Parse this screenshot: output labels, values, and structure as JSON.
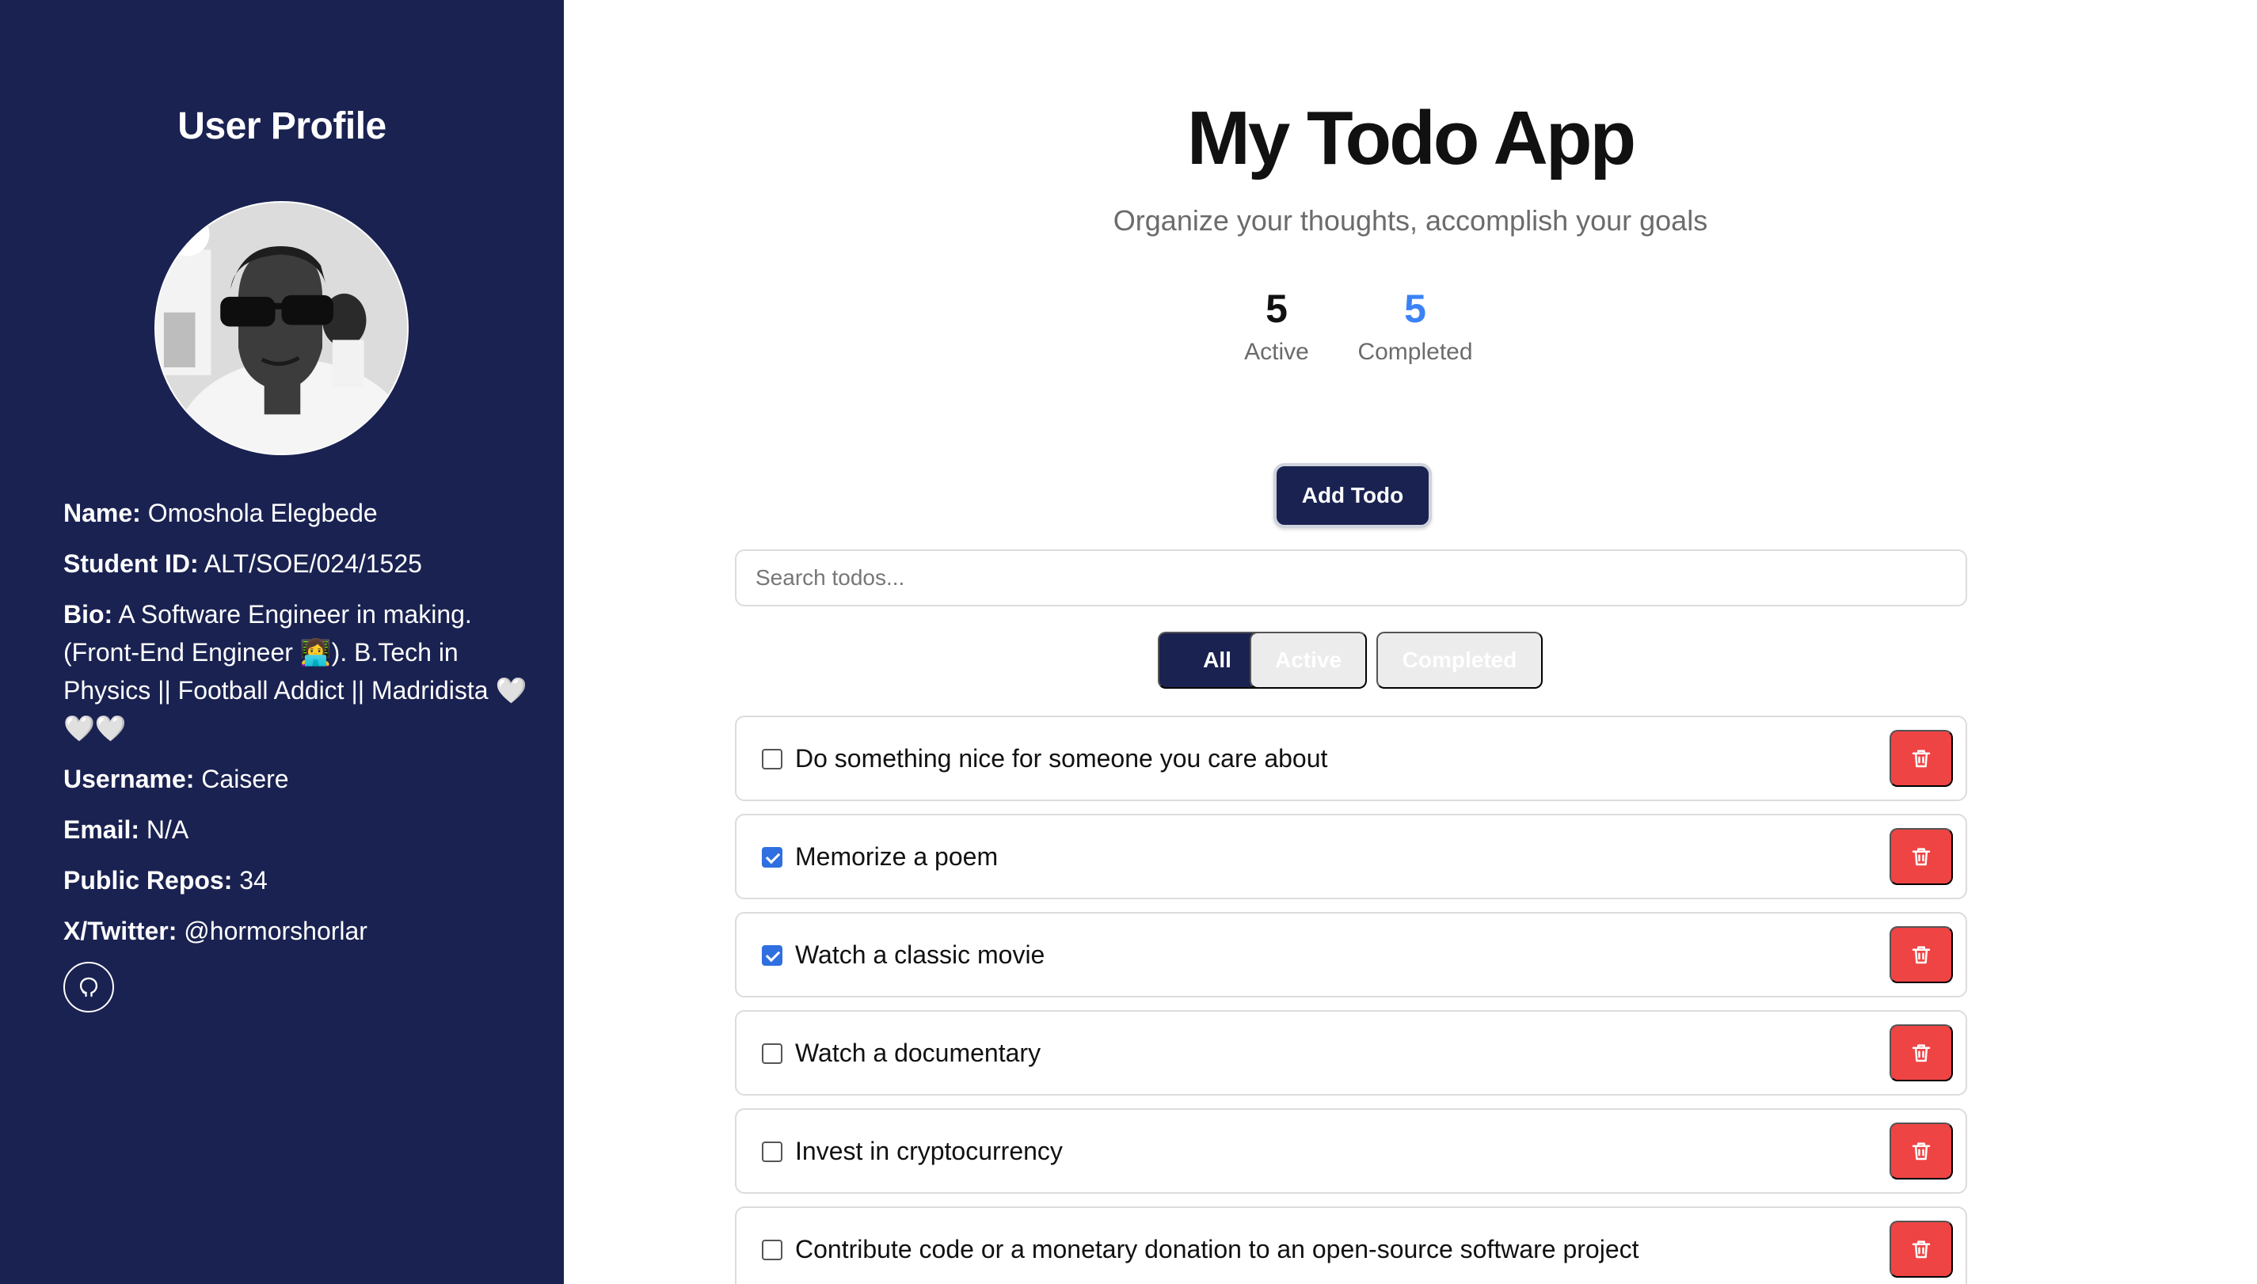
{
  "sidebar": {
    "title": "User Profile",
    "fields": [
      {
        "label": "Name:",
        "value": "Omoshola Elegbede"
      },
      {
        "label": "Student ID:",
        "value": "ALT/SOE/024/1525"
      },
      {
        "label": "Bio:",
        "value": "A Software Engineer in making. (Front-End Engineer 👩‍💻). B.Tech in Physics || Football Addict || Madridista 🤍🤍🤍"
      },
      {
        "label": "Username:",
        "value": "Caisere"
      },
      {
        "label": "Email:",
        "value": "N/A"
      },
      {
        "label": "Public Repos:",
        "value": "34"
      },
      {
        "label": "X/Twitter:",
        "value": "@hormorshorlar"
      }
    ],
    "github_icon": "github-icon"
  },
  "main": {
    "title": "My Todo App",
    "subtitle": "Organize your thoughts, accomplish your goals",
    "stats": {
      "active_count": "5",
      "active_label": "Active",
      "completed_count": "5",
      "completed_label": "Completed"
    },
    "add_button": "Add Todo",
    "search_placeholder": "Search todos...",
    "filters": {
      "all": "All",
      "active": "Active",
      "completed": "Completed"
    },
    "selected_filter": "All",
    "todos": [
      {
        "text": "Do something nice for someone you care about",
        "completed": false
      },
      {
        "text": "Memorize a poem",
        "completed": true
      },
      {
        "text": "Watch a classic movie",
        "completed": true
      },
      {
        "text": "Watch a documentary",
        "completed": false
      },
      {
        "text": "Invest in cryptocurrency",
        "completed": false
      },
      {
        "text": "Contribute code or a monetary donation to an open-source software project",
        "completed": false
      }
    ]
  },
  "colors": {
    "sidebar_bg": "#1a2251",
    "primary": "#1a2251",
    "completed_stat": "#3b82f6",
    "delete": "#ef4444",
    "checkbox_checked": "#2f6fe0"
  }
}
